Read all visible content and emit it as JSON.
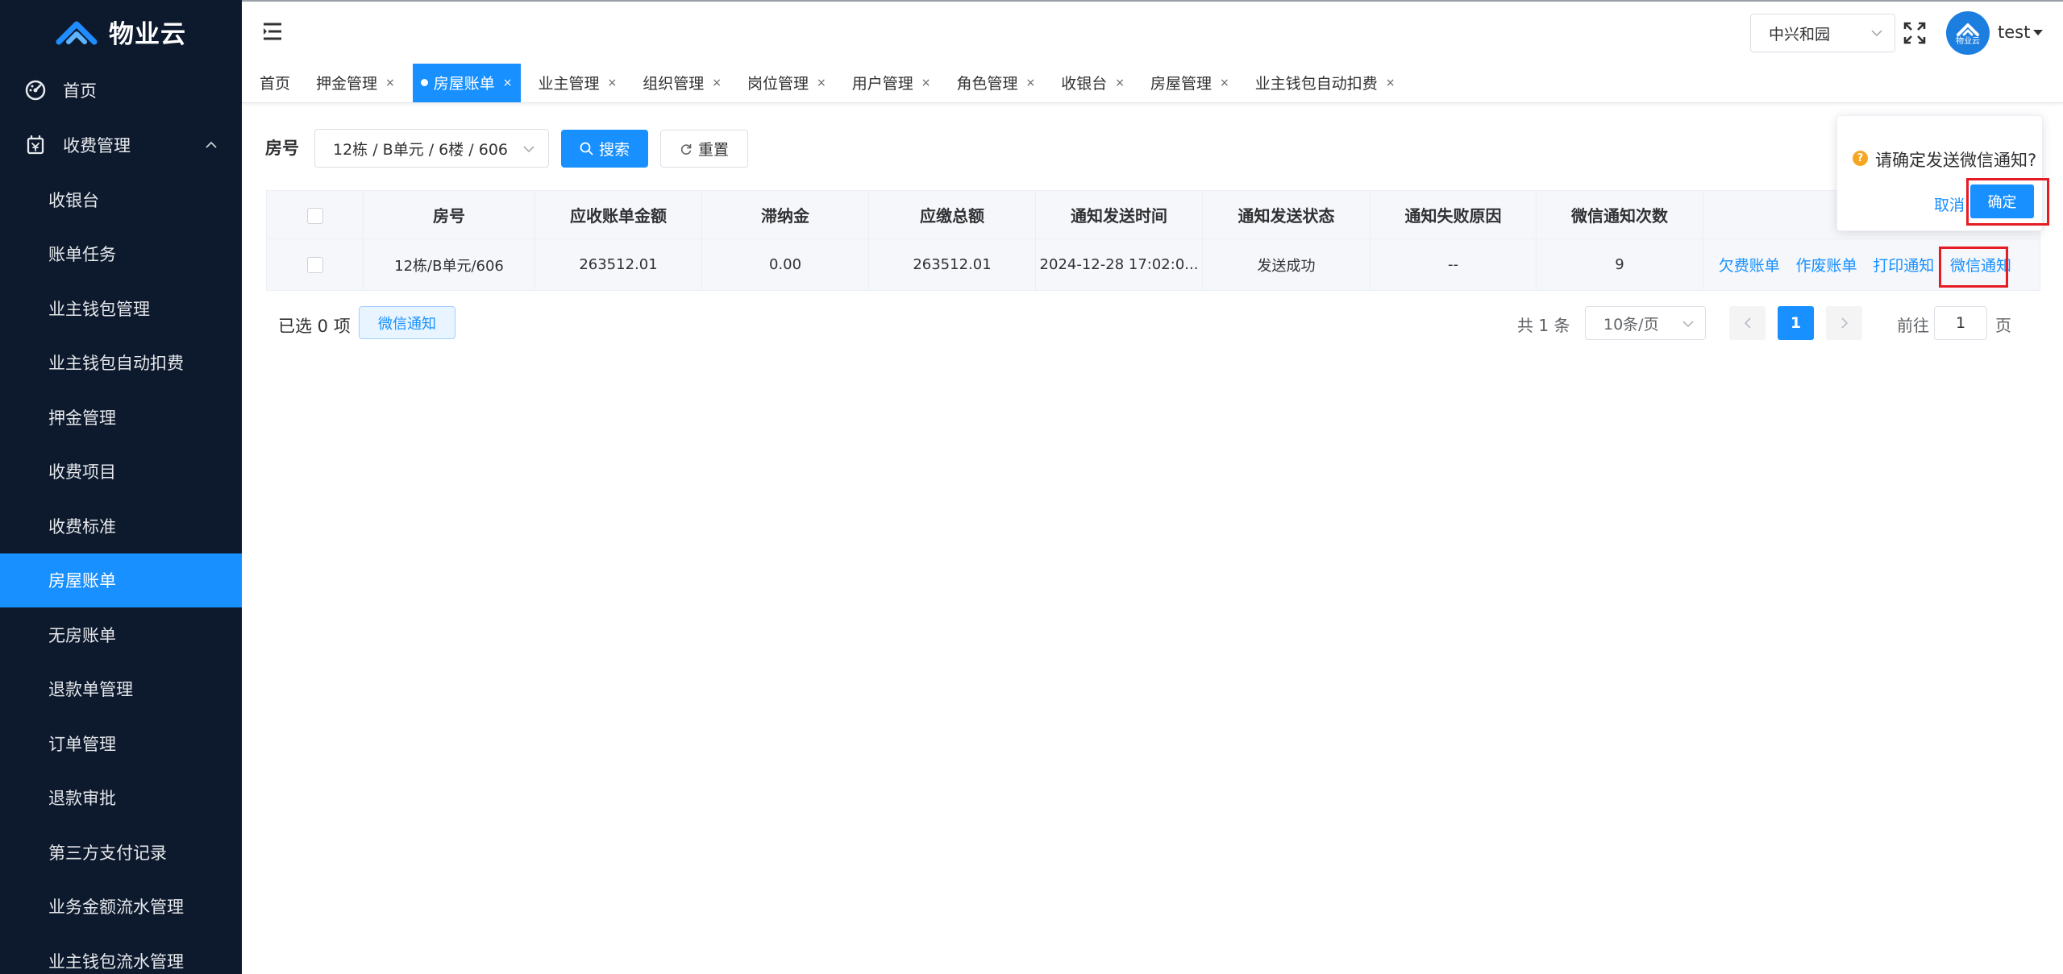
{
  "brand": {
    "name": "物业云"
  },
  "sidebar": {
    "home_label": "首页",
    "fees_label": "收费管理",
    "items": [
      {
        "label": "收银台",
        "active": false
      },
      {
        "label": "账单任务",
        "active": false
      },
      {
        "label": "业主钱包管理",
        "active": false
      },
      {
        "label": "业主钱包自动扣费",
        "active": false
      },
      {
        "label": "押金管理",
        "active": false
      },
      {
        "label": "收费项目",
        "active": false
      },
      {
        "label": "收费标准",
        "active": false
      },
      {
        "label": "房屋账单",
        "active": true
      },
      {
        "label": "无房账单",
        "active": false
      },
      {
        "label": "退款单管理",
        "active": false
      },
      {
        "label": "订单管理",
        "active": false
      },
      {
        "label": "退款审批",
        "active": false
      },
      {
        "label": "第三方支付记录",
        "active": false
      },
      {
        "label": "业务金额流水管理",
        "active": false
      },
      {
        "label": "业主钱包流水管理",
        "active": false
      }
    ]
  },
  "header": {
    "community": "中兴和园",
    "avatar_text": "物业云",
    "username": "test"
  },
  "tabs": [
    {
      "label": "首页",
      "active": false,
      "closable": false
    },
    {
      "label": "押金管理",
      "active": false,
      "closable": true
    },
    {
      "label": "房屋账单",
      "active": true,
      "closable": true
    },
    {
      "label": "业主管理",
      "active": false,
      "closable": true
    },
    {
      "label": "组织管理",
      "active": false,
      "closable": true
    },
    {
      "label": "岗位管理",
      "active": false,
      "closable": true
    },
    {
      "label": "用户管理",
      "active": false,
      "closable": true
    },
    {
      "label": "角色管理",
      "active": false,
      "closable": true
    },
    {
      "label": "收银台",
      "active": false,
      "closable": true
    },
    {
      "label": "房屋管理",
      "active": false,
      "closable": true
    },
    {
      "label": "业主钱包自动扣费",
      "active": false,
      "closable": true
    }
  ],
  "tab_close_glyph": "×",
  "search": {
    "label": "房号",
    "room_value": "12栋 / B单元 / 6楼 / 606",
    "search_button": "搜索",
    "reset_button": "重置"
  },
  "table": {
    "columns": [
      "房号",
      "应收账单金额",
      "滞纳金",
      "应缴总额",
      "通知发送时间",
      "通知发送状态",
      "通知失败原因",
      "微信通知次数"
    ],
    "rows": [
      {
        "room": "12栋/B单元/606",
        "receivable": "263512.01",
        "late_fee": "0.00",
        "total_due": "263512.01",
        "notify_time": "2024-12-28 17:02:0...",
        "notify_status": "发送成功",
        "fail_reason": "--",
        "wechat_count": "9",
        "actions": [
          "欠费账单",
          "作废账单",
          "打印通知",
          "微信通知"
        ]
      }
    ]
  },
  "footer": {
    "selected": "已选 0 项",
    "batch_wechat": "微信通知",
    "total": "共 1 条",
    "page_size": "10条/页",
    "current_page": "1",
    "goto_label": "前往",
    "goto_value": "1",
    "page_unit": "页"
  },
  "popconfirm": {
    "icon": "?",
    "message": "请确定发送微信通知?",
    "cancel": "取消",
    "confirm": "确定"
  },
  "colors": {
    "primary": "#1890ff",
    "sidebar_bg": "#0d1a2d",
    "highlight_box": "#e51c23",
    "warning": "#f5a623"
  }
}
